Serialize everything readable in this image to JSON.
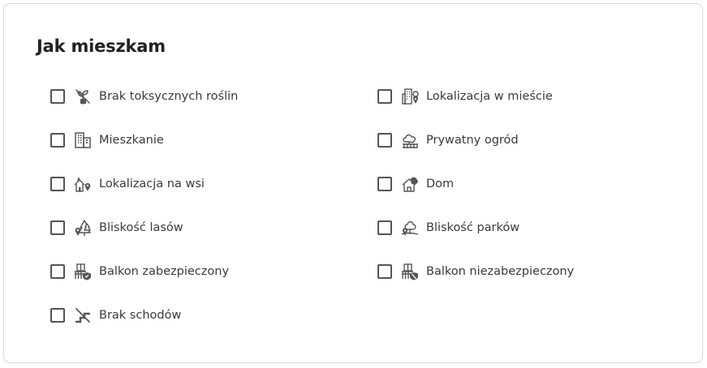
{
  "section": {
    "title": "Jak mieszkam"
  },
  "options": [
    {
      "label": "Brak toksycznych roślin",
      "icon": "no-toxic-plants-icon",
      "checked": false
    },
    {
      "label": "Lokalizacja w mieście",
      "icon": "city-location-icon",
      "checked": false
    },
    {
      "label": "Mieszkanie",
      "icon": "apartment-building-icon",
      "checked": false
    },
    {
      "label": "Prywatny ogród",
      "icon": "private-garden-icon",
      "checked": false
    },
    {
      "label": "Lokalizacja na wsi",
      "icon": "village-location-icon",
      "checked": false
    },
    {
      "label": "Dom",
      "icon": "house-icon",
      "checked": false
    },
    {
      "label": "Bliskość lasów",
      "icon": "forest-nearby-icon",
      "checked": false
    },
    {
      "label": "Bliskość parków",
      "icon": "park-nearby-icon",
      "checked": false
    },
    {
      "label": "Balkon zabezpieczony",
      "icon": "secured-balcony-icon",
      "checked": false
    },
    {
      "label": "Balkon niezabezpieczony",
      "icon": "unsecured-balcony-icon",
      "checked": false
    },
    {
      "label": "Brak schodów",
      "icon": "no-stairs-icon",
      "checked": false
    }
  ]
}
